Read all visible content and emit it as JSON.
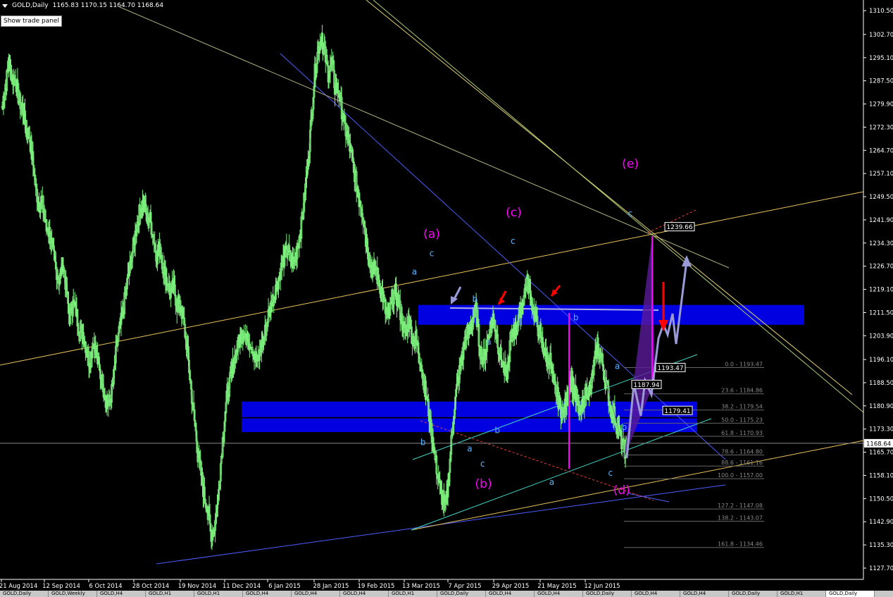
{
  "header": {
    "title": "GOLD,Daily",
    "ohlc": "1165.83 1170.15 1164.70 1168.64"
  },
  "trade_panel_button": "Show trade panel",
  "tabs": [
    {
      "label": "GOLD,Daily",
      "active": false
    },
    {
      "label": "GOLD,Weekly",
      "active": false
    },
    {
      "label": "GOLD,H4",
      "active": false
    },
    {
      "label": "GOLD,H1",
      "active": false
    },
    {
      "label": "GOLD,H1",
      "active": false
    },
    {
      "label": "GOLD,H4",
      "active": false
    },
    {
      "label": "GOLD,H4",
      "active": false
    },
    {
      "label": "GOLD,H4",
      "active": false
    },
    {
      "label": "GOLD,H1",
      "active": false
    },
    {
      "label": "GOLD,Daily",
      "active": false
    },
    {
      "label": "GOLD,H4",
      "active": false
    },
    {
      "label": "GOLD,H4",
      "active": false
    },
    {
      "label": "GOLD,Daily",
      "active": false
    },
    {
      "label": "GOLD,H4",
      "active": false
    },
    {
      "label": "GOLD,H4",
      "active": false
    },
    {
      "label": "GOLD,Daily",
      "active": false
    },
    {
      "label": "GOLD,H1",
      "active": false
    },
    {
      "label": "GOLD,Daily",
      "active": true
    }
  ],
  "chart_data": {
    "type": "candlestick",
    "symbol": "GOLD",
    "timeframe": "Daily",
    "ylim": [
      1124.0,
      1314.0
    ],
    "yticks": [
      1310.5,
      1302.7,
      1295.1,
      1287.5,
      1279.9,
      1272.3,
      1264.7,
      1257.1,
      1249.5,
      1241.9,
      1234.3,
      1226.7,
      1219.1,
      1211.5,
      1203.9,
      1196.1,
      1188.5,
      1180.9,
      1173.3,
      1165.7,
      1158.1,
      1150.5,
      1142.9,
      1135.3,
      1127.7
    ],
    "xticks": [
      "21 Aug 2014",
      "12 Sep 2014",
      "6 Oct 2014",
      "28 Oct 2014",
      "19 Nov 2014",
      "11 Dec 2014",
      "6 Jan 2015",
      "28 Jan 2015",
      "19 Feb 2015",
      "13 Mar 2015",
      "7 Apr 2015",
      "29 Apr 2015",
      "21 May 2015",
      "12 Jun 2015"
    ],
    "current_price": "1168.64",
    "path": [
      [
        1279,
        1285,
        1294,
        1288
      ],
      [
        1288,
        1281,
        1279,
        1272,
        1270,
        1262,
        1252,
        1247
      ],
      [
        1247,
        1240,
        1238,
        1232,
        1226,
        1222,
        1228,
        1220,
        1210,
        1215,
        1212,
        1205
      ],
      [
        1205,
        1200,
        1195,
        1202,
        1198,
        1192,
        1188,
        1182
      ],
      [
        1182,
        1188,
        1200,
        1206,
        1212,
        1220,
        1226,
        1233,
        1240,
        1245,
        1248,
        1242
      ],
      [
        1242,
        1236,
        1230,
        1232,
        1226,
        1222,
        1218,
        1220,
        1214
      ],
      [
        1214,
        1208,
        1200,
        1188,
        1178,
        1168,
        1160,
        1152,
        1148,
        1140
      ],
      [
        1140,
        1148,
        1162,
        1175,
        1185,
        1190,
        1196,
        1200,
        1204,
        1206,
        1202
      ],
      [
        1202,
        1198,
        1195,
        1200,
        1204,
        1210,
        1214,
        1218,
        1222,
        1226,
        1230,
        1232,
        1228
      ],
      [
        1228,
        1234,
        1240,
        1250,
        1262,
        1275,
        1290,
        1298,
        1302,
        1296,
        1290,
        1294,
        1285
      ],
      [
        1285,
        1278,
        1272,
        1268,
        1262,
        1256,
        1250,
        1246,
        1238,
        1230,
        1226
      ],
      [
        1226,
        1222,
        1218,
        1212,
        1210,
        1216,
        1218,
        1214,
        1208,
        1204,
        1210,
        1203
      ],
      [
        1203,
        1198,
        1192,
        1185,
        1178,
        1170,
        1162,
        1155,
        1150,
        1148,
        1160,
        1175,
        1185,
        1192,
        1198,
        1205
      ],
      [
        1205,
        1210,
        1212,
        1200,
        1196,
        1200,
        1206,
        1210,
        1205,
        1198,
        1194,
        1190,
        1200,
        1206
      ],
      [
        1206,
        1212,
        1216,
        1222,
        1218,
        1212,
        1208,
        1204,
        1200,
        1196
      ],
      [
        1196,
        1188,
        1185,
        1180,
        1178,
        1184,
        1190,
        1186,
        1182,
        1178,
        1183,
        1186
      ],
      [
        1186,
        1194,
        1200,
        1198,
        1192,
        1186,
        1180,
        1178,
        1174,
        1170,
        1166,
        1169
      ]
    ],
    "wave_labels": [
      {
        "text": "(a)",
        "color": "#ff00ff",
        "x_idx": 0.5,
        "y": 1236.0,
        "size": 17
      },
      {
        "text": "(b)",
        "color": "#ff00ff",
        "x_idx": 0.56,
        "y": 1154.0,
        "size": 17
      },
      {
        "text": "(c)",
        "color": "#ff00ff",
        "x_idx": 0.595,
        "y": 1243.0,
        "size": 17
      },
      {
        "text": "(d)",
        "color": "#ff00ff",
        "x_idx": 0.72,
        "y": 1152.0,
        "size": 17
      },
      {
        "text": "(e)",
        "color": "#ff00ff",
        "x_idx": 0.73,
        "y": 1259.0,
        "size": 17
      },
      {
        "text": "a",
        "color": "#5ab4ff",
        "x_idx": 0.48,
        "y": 1224.0,
        "size": 12
      },
      {
        "text": "c",
        "color": "#5ab4ff",
        "x_idx": 0.5,
        "y": 1230.0,
        "size": 12
      },
      {
        "text": "b",
        "color": "#5ab4ff",
        "x_idx": 0.55,
        "y": 1215.0,
        "size": 12
      },
      {
        "text": "a",
        "color": "#5ab4ff",
        "x_idx": 0.566,
        "y": 1201.0,
        "size": 12
      },
      {
        "text": "c",
        "color": "#5ab4ff",
        "x_idx": 0.594,
        "y": 1234.0,
        "size": 12
      },
      {
        "text": "b",
        "color": "#5ab4ff",
        "x_idx": 0.667,
        "y": 1209.0,
        "size": 12
      },
      {
        "text": "b",
        "color": "#5ab4ff",
        "x_idx": 0.49,
        "y": 1168.0,
        "size": 12
      },
      {
        "text": "a",
        "color": "#5ab4ff",
        "x_idx": 0.544,
        "y": 1166.0,
        "size": 12
      },
      {
        "text": "c",
        "color": "#5ab4ff",
        "x_idx": 0.559,
        "y": 1161.0,
        "size": 12
      },
      {
        "text": "b",
        "color": "#5ab4ff",
        "x_idx": 0.576,
        "y": 1172.0,
        "size": 12
      },
      {
        "text": "a",
        "color": "#5ab4ff",
        "x_idx": 0.639,
        "y": 1155.0,
        "size": 12
      },
      {
        "text": "c",
        "color": "#5ab4ff",
        "x_idx": 0.707,
        "y": 1158.0,
        "size": 12
      },
      {
        "text": "a",
        "color": "#5ab4ff",
        "x_idx": 0.715,
        "y": 1193.0,
        "size": 12
      },
      {
        "text": "b",
        "color": "#5ab4ff",
        "x_idx": 0.723,
        "y": 1173.0,
        "size": 12
      },
      {
        "text": "c",
        "color": "#5ab4ff",
        "x_idx": 0.73,
        "y": 1243.0,
        "size": 12
      }
    ],
    "fib_levels": [
      {
        "label": "0.0 - 1193.47",
        "y": 1193.47
      },
      {
        "label": "23.6 - 1184.86",
        "y": 1184.86
      },
      {
        "label": "38.2 - 1179.54",
        "y": 1179.54
      },
      {
        "label": "50.0 - 1175.23",
        "y": 1175.23
      },
      {
        "label": "61.8 - 1170.93",
        "y": 1170.93
      },
      {
        "label": "78.6 - 1164.80",
        "y": 1164.8
      },
      {
        "label": "88.6 - 1161.16",
        "y": 1161.16
      },
      {
        "label": "100.0 - 1157.00",
        "y": 1157.0
      },
      {
        "label": "127.2 - 1147.08",
        "y": 1147.08
      },
      {
        "label": "138.2 - 1143.07",
        "y": 1143.07
      },
      {
        "label": "161.8 - 1134.46",
        "y": 1134.46
      }
    ],
    "price_tags": [
      {
        "label": "1239.66",
        "y": 1239.66
      },
      {
        "label": "1193.47",
        "y": 1193.47
      },
      {
        "label": "1187.94",
        "y": 1187.94
      },
      {
        "label": "1179.41",
        "y": 1179.41
      }
    ],
    "zones": [
      {
        "y_top": 1214.0,
        "y_bottom": 1207.5,
        "color": "#0000e0"
      },
      {
        "y_top": 1182.3,
        "y_bottom": 1177.2,
        "color": "#0000e0"
      },
      {
        "y_top": 1176.8,
        "y_bottom": 1172.3,
        "color": "#0000e0"
      }
    ],
    "colors": {
      "candle": "#7cf07c",
      "background": "#000000",
      "axis_text": "#ffffff",
      "zone": "#0000e0",
      "label_major": "#ff00ff",
      "label_minor": "#5ab4ff",
      "arrow_red": "#ff0000",
      "arrow_path": "#9a9ad8"
    }
  }
}
